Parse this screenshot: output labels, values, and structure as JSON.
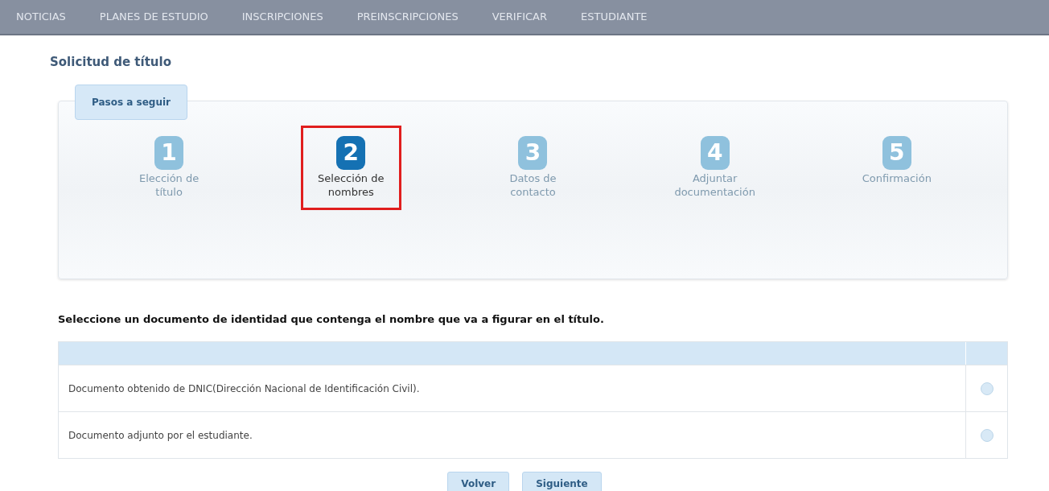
{
  "nav": {
    "items": [
      "NOTICIAS",
      "PLANES DE ESTUDIO",
      "INSCRIPCIONES",
      "PREINSCRIPCIONES",
      "VERIFICAR",
      "ESTUDIANTE"
    ]
  },
  "page_title": "Solicitud de título",
  "steps_panel": {
    "tab": "Pasos a seguir",
    "steps": [
      {
        "number": "1",
        "label": "Elección de título",
        "selected": false
      },
      {
        "number": "2",
        "label": "Selección de nombres",
        "selected": true
      },
      {
        "number": "3",
        "label": "Datos de contacto",
        "selected": false
      },
      {
        "number": "4",
        "label": "Adjuntar documentación",
        "selected": false
      },
      {
        "number": "5",
        "label": "Confirmación",
        "selected": false
      }
    ]
  },
  "instruction": "Seleccione un documento de identidad que contenga el nombre que va a figurar en el título.",
  "options": [
    {
      "label": "Documento obtenido de DNIC(Dirección Nacional de Identificación Civil).",
      "selected": false
    },
    {
      "label": "Documento adjunto por el estudiante.",
      "selected": false
    }
  ],
  "buttons": [
    "Volver",
    "Siguiente"
  ]
}
